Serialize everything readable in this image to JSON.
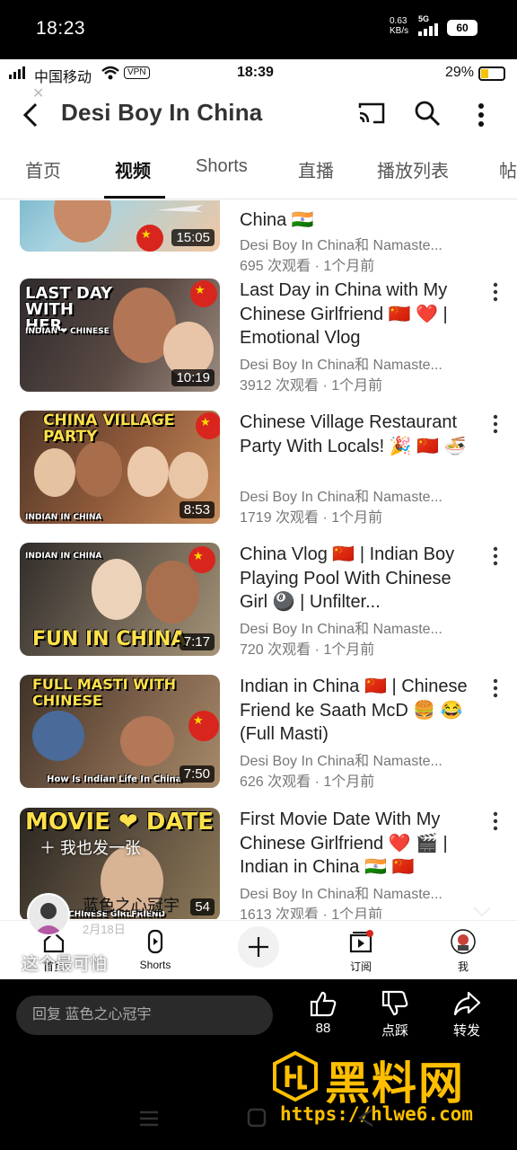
{
  "outer_status": {
    "time": "18:23",
    "net_speed": "0.63",
    "net_unit": "KB/s",
    "network": "5G",
    "battery": "60"
  },
  "inner_status": {
    "carrier": "中国移动",
    "vpn": "VPN",
    "time": "18:39",
    "battery_pct": "29%"
  },
  "header": {
    "channel_title": "Desi Boy In China",
    "icons": [
      "back-arrow-icon",
      "cast-icon",
      "search-icon",
      "more-vert-icon"
    ]
  },
  "tabs": [
    {
      "label": "首页",
      "active": false
    },
    {
      "label": "视频",
      "active": true
    },
    {
      "label": "Shorts",
      "active": false
    },
    {
      "label": "直播",
      "active": false
    },
    {
      "label": "播放列表",
      "active": false
    },
    {
      "label": "帖",
      "active": false
    }
  ],
  "videos": [
    {
      "title": "China 🇮🇳",
      "channel": "Desi Boy In China和 Namaste...",
      "stats": "695 次观看 · 1个月前",
      "duration": "15:05",
      "thumb_text": "",
      "thumb_colors": [
        "#6db3c9",
        "#f2c9a6"
      ]
    },
    {
      "title": "Last Day in China with My Chinese Girlfriend 🇨🇳 ❤️ | Emotional Vlog",
      "channel": "Desi Boy In China和 Namaste...",
      "stats": "3912 次观看 · 1个月前",
      "duration": "10:19",
      "thumb_text": "LAST DAY WITH HER",
      "thumb_sub": "INDIAN ❤ CHINESE",
      "thumb_colors": [
        "#3a3030",
        "#8a7a70"
      ]
    },
    {
      "title": "Chinese Village Restaurant Party With Locals! 🎉 🇨🇳 🍜",
      "channel": "Desi Boy In China和 Namaste...",
      "stats": "1719 次观看 · 1个月前",
      "duration": "8:53",
      "thumb_text": "CHINA VILLAGE PARTY",
      "thumb_sub": "INDIAN IN CHINA",
      "thumb_colors": [
        "#5a3a2a",
        "#c07b4a"
      ]
    },
    {
      "title": "China Vlog 🇨🇳 | Indian Boy Playing Pool With Chinese Girl 🎱 | Unfilter...",
      "channel": "Desi Boy In China和 Namaste...",
      "stats": "720 次观看 · 1个月前",
      "duration": "7:17",
      "thumb_text": "FUN IN CHINA",
      "thumb_sub": "INDIAN IN CHINA",
      "thumb_colors": [
        "#3d3a36",
        "#9a8a72"
      ]
    },
    {
      "title": "Indian in China 🇨🇳 | Chinese Friend ke Saath McD 🍔 😂 (Full Masti)",
      "channel": "Desi Boy In China和 Namaste...",
      "stats": "626 次观看 · 1个月前",
      "duration": "7:50",
      "thumb_text": "FULL MASTI WITH CHINESE",
      "thumb_sub": "How Is Indian Life In China",
      "thumb_colors": [
        "#4a3a30",
        "#8a6a52"
      ]
    },
    {
      "title": "First Movie Date With My Chinese Girlfriend ❤️ 🎬 | Indian in China 🇮🇳 🇨🇳",
      "channel": "Desi Boy In China和 Namaste...",
      "stats": "1613 次观看 · 1个月前",
      "duration": "54",
      "thumb_text": "MOVIE ❤ DATE",
      "thumb_sub": "CHINESE GIRLFRIEND",
      "thumb_colors": [
        "#2a2a2a",
        "#6a5a40"
      ]
    }
  ],
  "bottom_nav": [
    {
      "label": "首页",
      "icon": "home-icon"
    },
    {
      "label": "Shorts",
      "icon": "shorts-icon"
    },
    {
      "label": "",
      "icon": "create-plus-icon"
    },
    {
      "label": "订阅",
      "icon": "subscriptions-icon"
    },
    {
      "label": "我",
      "icon": "profile-avatar-icon"
    }
  ],
  "overlay": {
    "add_text": "＋ 我也发一张",
    "username": "蓝色之心冠宇",
    "date": "2月18日",
    "caption": "这个最可怕"
  },
  "actions": {
    "reply_placeholder": "回复 蓝色之心冠宇",
    "like_count": "88",
    "dislike_label": "点踩",
    "share_label": "转发"
  },
  "watermark": {
    "brand": "黑料网",
    "url": "https://hlwe6.com"
  },
  "colors": {
    "accent_red": "#d8261e",
    "watermark_gold": "#ffbf00"
  }
}
